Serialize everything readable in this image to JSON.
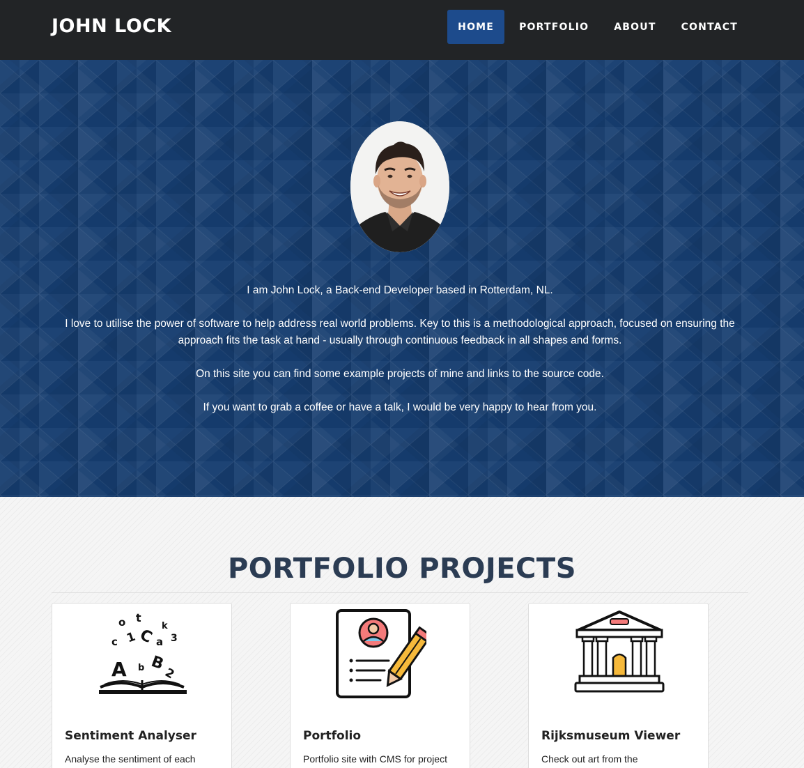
{
  "site": {
    "brand": "JOHN LOCK"
  },
  "nav": {
    "items": [
      {
        "label": "HOME",
        "active": true
      },
      {
        "label": "PORTFOLIO",
        "active": false
      },
      {
        "label": "ABOUT",
        "active": false
      },
      {
        "label": "CONTACT",
        "active": false
      }
    ]
  },
  "hero": {
    "paragraphs": [
      "I am John Lock, a Back-end Developer based in Rotterdam, NL.",
      "I love to utilise the power of software to help address real world problems. Key to this is a methodological approach, focused on ensuring the approach fits the task at hand - usually through continuous feedback in all shapes and forms.",
      "On this site you can find some example projects of mine and links to the source code.",
      "If you want to grab a coffee or have a talk, I would be very happy to hear from you."
    ]
  },
  "portfolio": {
    "title": "PORTFOLIO PROJECTS",
    "projects": [
      {
        "title": "Sentiment Analyser",
        "description": "Analyse the sentiment of each",
        "icon": "letters-book-icon"
      },
      {
        "title": "Portfolio",
        "description": "Portfolio site with CMS for project",
        "icon": "resume-pencil-icon"
      },
      {
        "title": "Rijksmuseum Viewer",
        "description": "Check out art from the",
        "icon": "museum-icon"
      }
    ]
  },
  "colors": {
    "navbar": "#222426",
    "active_nav": "#1d4b8c",
    "hero": "#163d6f",
    "title": "#2b3c53"
  }
}
